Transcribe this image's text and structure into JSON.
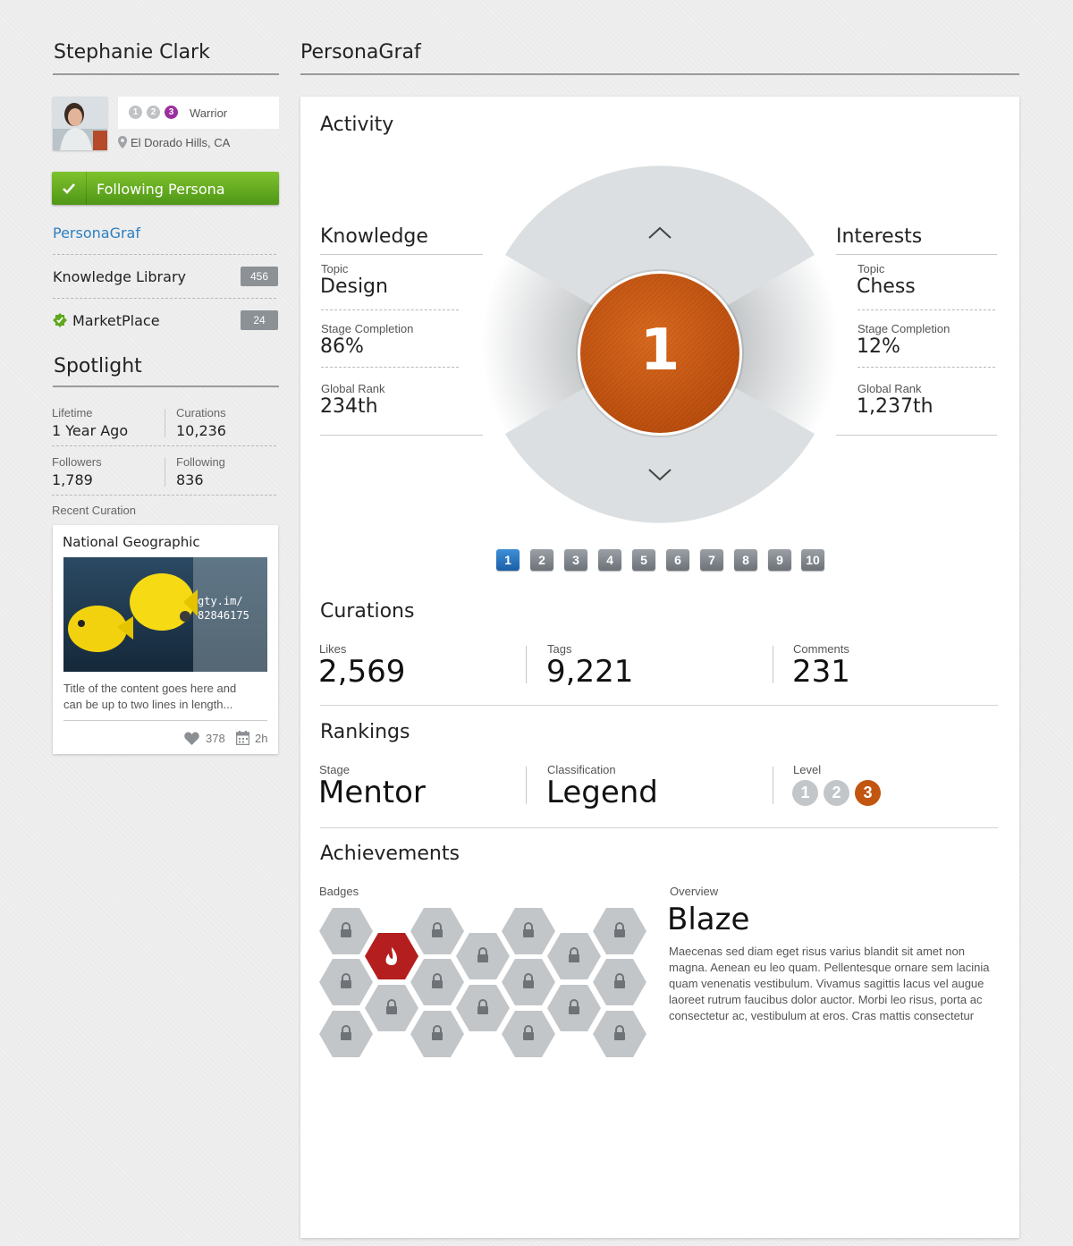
{
  "profile": {
    "name": "Stephanie Clark",
    "levels": [
      "1",
      "2",
      "3"
    ],
    "rank_title": "Warrior",
    "location": "El Dorado Hills, CA",
    "follow_label": "Following Persona"
  },
  "nav": {
    "active": "PersonaGraf",
    "items": [
      {
        "label": "Knowledge Library",
        "count": "456"
      },
      {
        "label": "MarketPlace",
        "count": "24"
      }
    ]
  },
  "spotlight": {
    "title": "Spotlight",
    "stats": [
      {
        "label": "Lifetime",
        "value": "1 Year Ago"
      },
      {
        "label": "Curations",
        "value": "10,236"
      },
      {
        "label": "Followers",
        "value": "1,789"
      },
      {
        "label": "Following",
        "value": "836"
      }
    ],
    "recent_label": "Recent Curation",
    "card": {
      "source": "National Geographic",
      "image_caption_1": "gty.im/",
      "image_caption_2": "82846175",
      "description": "Title of the content goes here and can be up to two lines in length...",
      "likes": "378",
      "age": "2h"
    }
  },
  "main": {
    "title": "PersonaGraf",
    "activity": {
      "title": "Activity",
      "center_value": "1",
      "knowledge": {
        "title": "Knowledge",
        "topic_label": "Topic",
        "topic": "Design",
        "stage_label": "Stage Completion",
        "stage": "86%",
        "rank_label": "Global Rank",
        "rank": "234th"
      },
      "interests": {
        "title": "Interests",
        "topic_label": "Topic",
        "topic": "Chess",
        "stage_label": "Stage Completion",
        "stage": "12%",
        "rank_label": "Global Rank",
        "rank": "1,237th"
      },
      "pages": [
        "1",
        "2",
        "3",
        "4",
        "5",
        "6",
        "7",
        "8",
        "9",
        "10"
      ],
      "active_page": "1"
    },
    "curations": {
      "title": "Curations",
      "stats": [
        {
          "label": "Likes",
          "value": "2,569"
        },
        {
          "label": "Tags",
          "value": "9,221"
        },
        {
          "label": "Comments",
          "value": "231"
        }
      ]
    },
    "rankings": {
      "title": "Rankings",
      "stage_label": "Stage",
      "stage": "Mentor",
      "class_label": "Classification",
      "class": "Legend",
      "level_label": "Level",
      "levels": [
        "1",
        "2",
        "3"
      ]
    },
    "achievements": {
      "title": "Achievements",
      "badges_label": "Badges",
      "overview_label": "Overview",
      "overview_title": "Blaze",
      "overview_text": "Maecenas sed diam eget risus varius blandit sit amet non magna. Aenean eu leo quam. Pellentesque ornare sem lacinia quam venenatis vestibulum. Vivamus sagittis lacus vel augue laoreet rutrum faucibus dolor auctor. Morbi leo risus, porta ac consectetur ac, vestibulum at eros. Cras mattis consectetur"
    }
  },
  "colors": {
    "accent_orange": "#c2550f",
    "level_purple": "#9b2f9e",
    "green": "#5fa81e",
    "link_blue": "#2d7fc1",
    "badge_red": "#b41e1e"
  }
}
